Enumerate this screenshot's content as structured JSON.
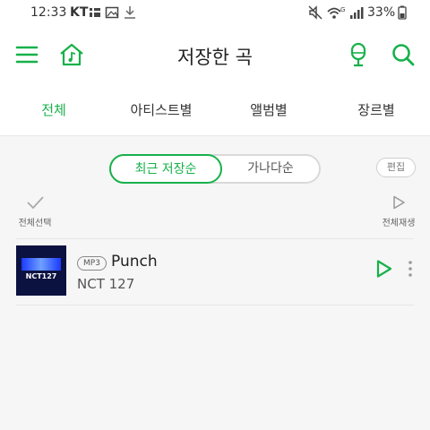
{
  "status_bar": {
    "time": "12:33",
    "carrier": "KT",
    "battery": "33%"
  },
  "header": {
    "title": "저장한 곡"
  },
  "tabs": [
    {
      "label": "전체",
      "active": true
    },
    {
      "label": "아티스트별",
      "active": false
    },
    {
      "label": "앨범별",
      "active": false
    },
    {
      "label": "장르별",
      "active": false
    }
  ],
  "sort": {
    "active": "최근 저장순",
    "inactive": "가나다순"
  },
  "edit_label": "편집",
  "select_all_label": "전체선택",
  "play_all_label": "전체재생",
  "tracks": [
    {
      "badge": "MP3",
      "title": "Punch",
      "artist": "NCT 127",
      "album_art_text": "NCT127"
    }
  ],
  "colors": {
    "accent": "#17b14a",
    "album_bg": "#0c1240"
  },
  "icons": {
    "menu": "hamburger-menu-icon",
    "home": "music-home-icon",
    "mic": "microphone-icon",
    "search": "search-icon",
    "check": "check-icon",
    "play": "play-icon",
    "more": "more-vertical-icon"
  }
}
